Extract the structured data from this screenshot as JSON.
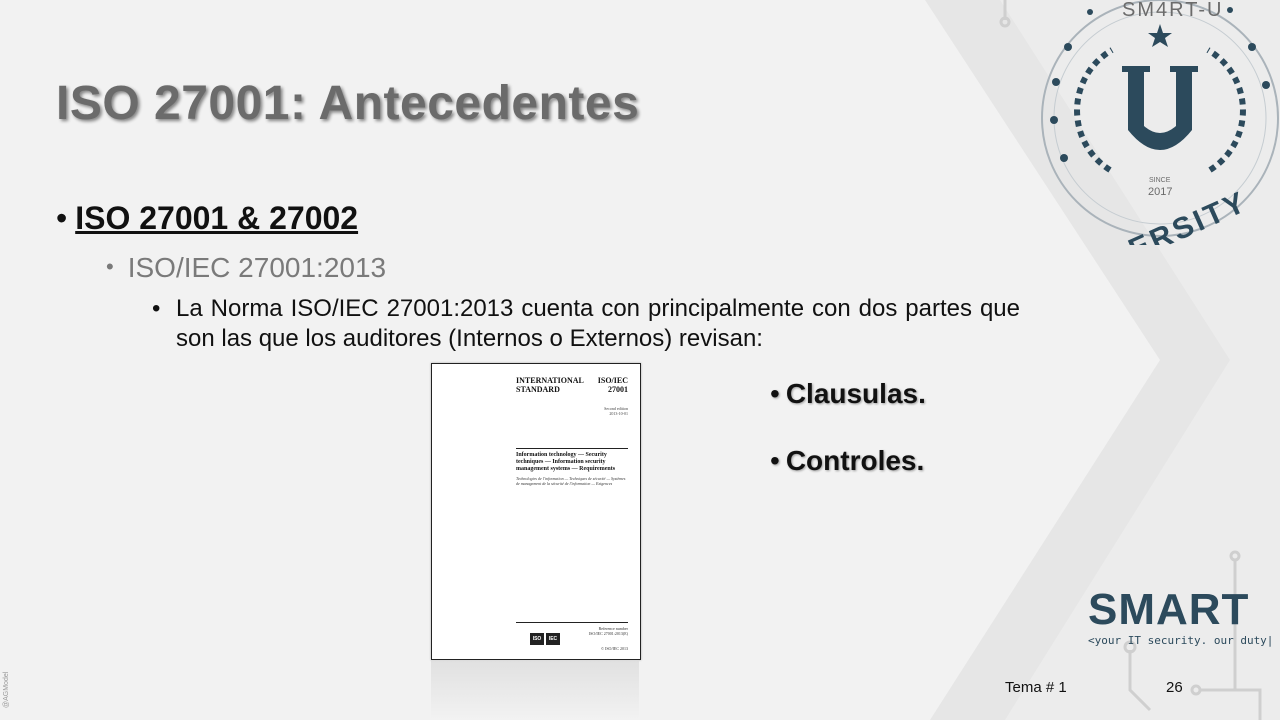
{
  "slide": {
    "title": "ISO 27001: Antecedentes",
    "bullet1": "ISO 27001 & 27002",
    "bullet2": "ISO/IEC 27001:2013",
    "bullet3": "La Norma ISO/IEC 27001:2013 cuenta con principalmente con dos partes que son las que los auditores (Internos o Externos) revisan:",
    "right_bullets": [
      "Clausulas.",
      "Controles."
    ],
    "bullet_glyph": "•"
  },
  "document_image": {
    "header_left": "INTERNATIONAL STANDARD",
    "header_right_top": "ISO/IEC",
    "header_right_bottom": "27001",
    "edition": "Second edition 2013-10-01",
    "title": "Information technology — Security techniques — Information security management systems — Requirements",
    "subtitle": "Technologies de l'information — Techniques de sécurité — Systèmes de management de la sécurité de l'information — Exigences",
    "reference": "Reference number ISO/IEC 27001:2013(E)",
    "copyright": "© ISO/IEC 2013",
    "logo_a": "ISO",
    "logo_b": "IEC"
  },
  "branding": {
    "seal_top": "SM4RT-U",
    "seal_bottom": "ERSITY",
    "seal_letter": "U",
    "seal_since": "SINCE",
    "seal_year": "2017",
    "logo_word": "SMART",
    "logo_tagline": "<your IT security. our duty|",
    "side_credit": "@AGModel"
  },
  "footer": {
    "label": "Tema # 1",
    "page": "26"
  },
  "colors": {
    "brand_navy": "#2c4a5c",
    "title_gray": "#6b6b6b",
    "subtext_gray": "#7a7a7a"
  }
}
